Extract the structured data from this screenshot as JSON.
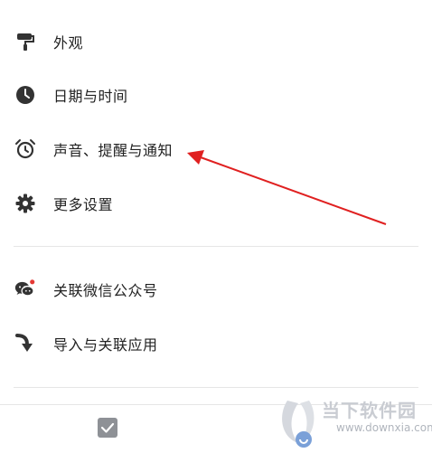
{
  "menu": {
    "items": [
      {
        "label": "外观",
        "icon": "paint-roller-icon"
      },
      {
        "label": "日期与时间",
        "icon": "clock-icon"
      },
      {
        "label": "声音、提醒与通知",
        "icon": "alarm-clock-icon"
      },
      {
        "label": "更多设置",
        "icon": "gear-icon"
      },
      {
        "label": "关联微信公众号",
        "icon": "wechat-icon"
      },
      {
        "label": "导入与关联应用",
        "icon": "import-arrow-icon"
      }
    ]
  },
  "annotation": {
    "color": "#e02020",
    "icon": "red-arrow-annotation"
  },
  "watermark": {
    "title": "当下软件园",
    "url": "www.downxia.com"
  },
  "colors": {
    "icon": "#333333",
    "badge": "#e53935",
    "divider": "#e6e6e6"
  }
}
